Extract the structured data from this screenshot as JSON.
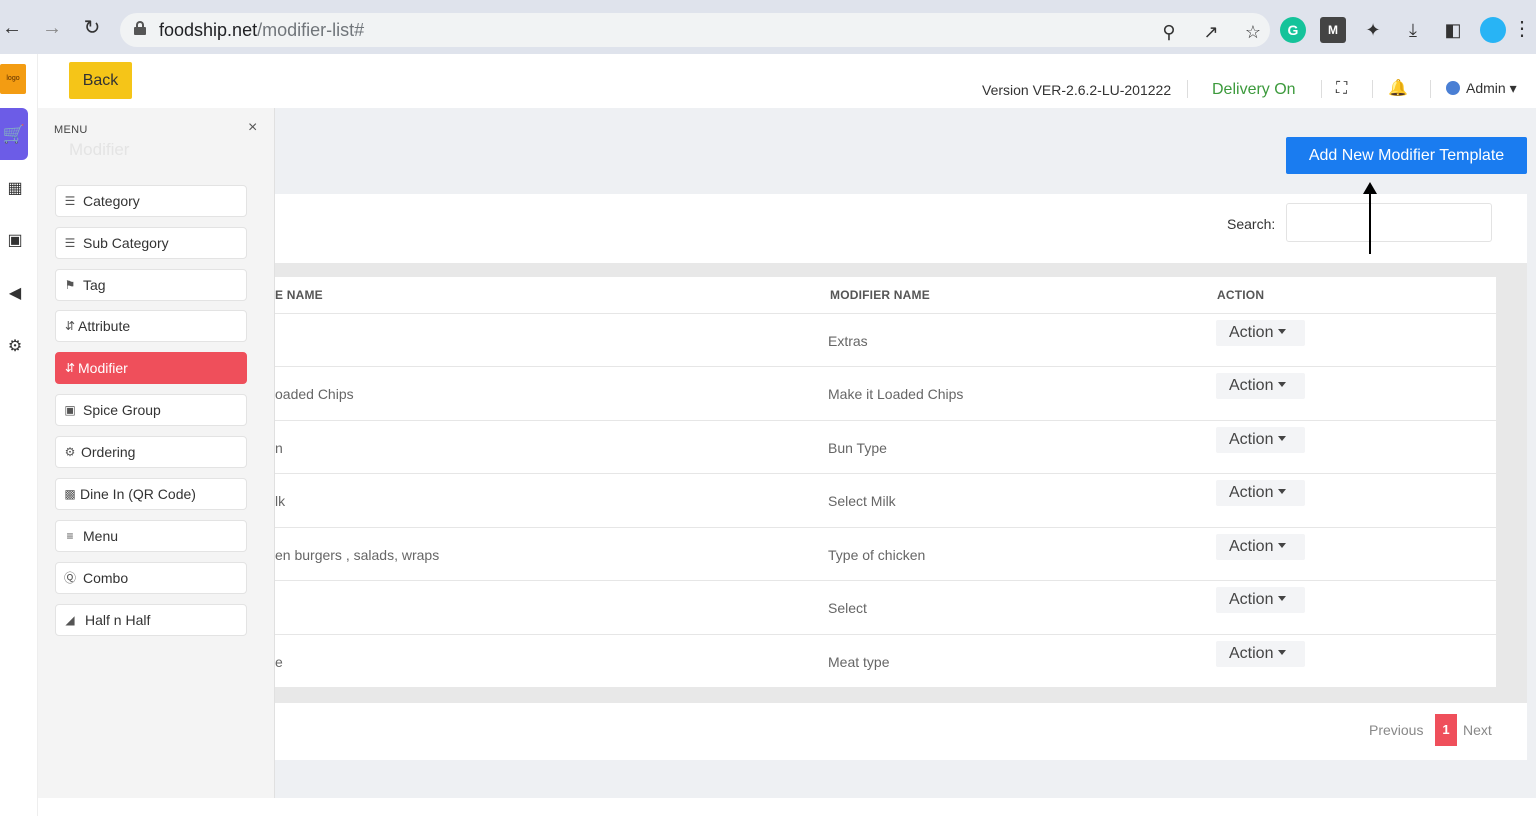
{
  "browser": {
    "url_domain": "foodship.net",
    "url_path": "/modifier-list#",
    "back_icon": "arrow-left-icon",
    "forward_icon": "arrow-right-icon",
    "reload_icon": "reload-icon"
  },
  "header": {
    "back_label": "Back",
    "version": "Version VER-2.6.2-LU-201222",
    "delivery": "Delivery On",
    "admin": "Admin"
  },
  "menu": {
    "title": "MENU",
    "close": "×",
    "ghost_title": "Modifier",
    "items": [
      {
        "label": "Category",
        "icon": "list-icon"
      },
      {
        "label": "Sub Category",
        "icon": "list-icon"
      },
      {
        "label": "Tag",
        "icon": "tag-icon"
      },
      {
        "label": "Attribute",
        "icon": "sort-icon"
      },
      {
        "label": "Modifier",
        "icon": "sort-icon"
      },
      {
        "label": "Spice Group",
        "icon": "image-icon"
      },
      {
        "label": "Ordering",
        "icon": "gear-icon"
      },
      {
        "label": "Dine In (QR Code)",
        "icon": "qr-icon"
      },
      {
        "label": "Menu",
        "icon": "menu-icon"
      },
      {
        "label": "Combo",
        "icon": "combo-icon"
      },
      {
        "label": "Half n Half",
        "icon": "half-icon"
      }
    ]
  },
  "main": {
    "add_button": "Add New Modifier Template",
    "search_label": "Search:",
    "columns": {
      "template_name": "E NAME",
      "modifier_name": "MODIFIER NAME",
      "action": "ACTION"
    },
    "rows": [
      {
        "template": "",
        "modifier": "Extras",
        "action": "Action"
      },
      {
        "template": "oaded Chips",
        "modifier": "Make it Loaded Chips",
        "action": "Action"
      },
      {
        "template": "n",
        "modifier": "Bun Type",
        "action": "Action"
      },
      {
        "template": "lk",
        "modifier": "Select Milk",
        "action": "Action"
      },
      {
        "template": "en burgers , salads, wraps",
        "modifier": "Type of chicken",
        "action": "Action"
      },
      {
        "template": "",
        "modifier": "Select",
        "action": "Action"
      },
      {
        "template": "e",
        "modifier": "Meat type",
        "action": "Action"
      }
    ],
    "pagination": {
      "previous": "Previous",
      "current": "1",
      "next": "Next"
    }
  },
  "colors": {
    "accent_blue": "#1a7cf0",
    "active_red": "#ef4f5b",
    "back_yellow": "#f5c518",
    "delivery_green": "#3c9a3c",
    "rail_purple": "#6c5ce7"
  }
}
